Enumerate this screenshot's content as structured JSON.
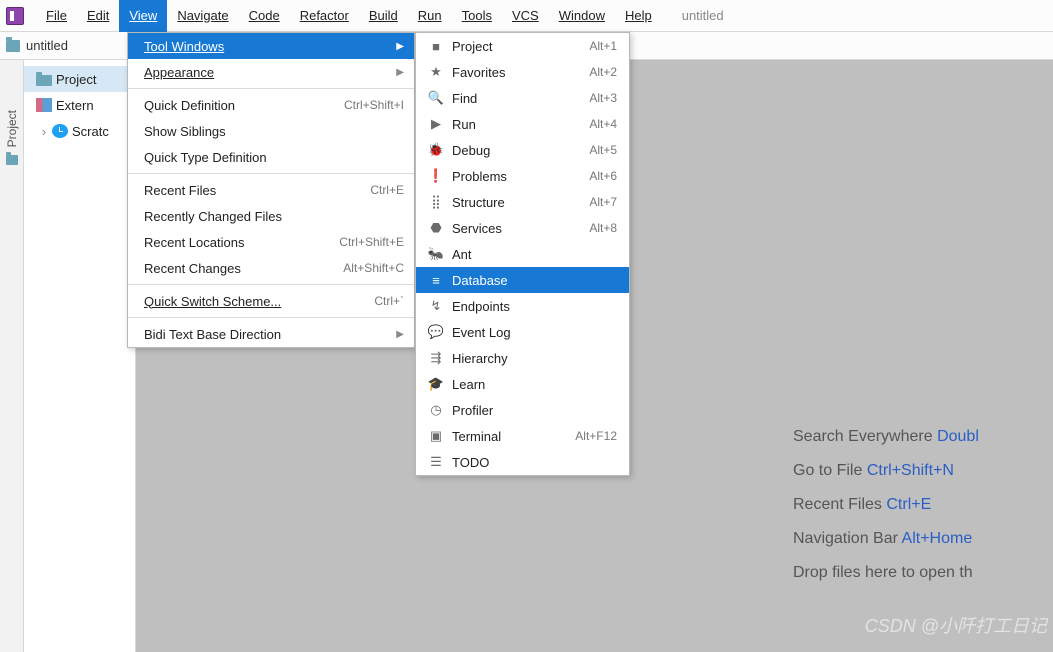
{
  "project_name": "untitled",
  "breadcrumb": "untitled",
  "menubar": {
    "file": "File",
    "edit": "Edit",
    "view": "View",
    "navigate": "Navigate",
    "code": "Code",
    "refactor": "Refactor",
    "build": "Build",
    "run": "Run",
    "tools": "Tools",
    "vcs": "VCS",
    "window": "Window",
    "help": "Help"
  },
  "gutter": {
    "project": "Project"
  },
  "tree": {
    "project": "Project",
    "external": "Extern",
    "scratches": "Scratc"
  },
  "view_menu": {
    "tool_windows": "Tool Windows",
    "appearance": "Appearance",
    "quick_def": {
      "label": "Quick Definition",
      "sc": "Ctrl+Shift+I"
    },
    "show_siblings": "Show Siblings",
    "quick_type_def": "Quick Type Definition",
    "recent_files": {
      "label": "Recent Files",
      "sc": "Ctrl+E"
    },
    "recently_changed": "Recently Changed Files",
    "recent_locations": {
      "label": "Recent Locations",
      "sc": "Ctrl+Shift+E"
    },
    "recent_changes": {
      "label": "Recent Changes",
      "sc": "Alt+Shift+C"
    },
    "quick_switch": {
      "label": "Quick Switch Scheme...",
      "sc": "Ctrl+`"
    },
    "bidi": "Bidi Text Base Direction"
  },
  "tool_windows_submenu": [
    {
      "icon": "project-icon",
      "glyph": "■",
      "label": "Project",
      "sc": "Alt+1"
    },
    {
      "icon": "favorites-icon",
      "glyph": "★",
      "label": "Favorites",
      "sc": "Alt+2"
    },
    {
      "icon": "find-icon",
      "glyph": "🔍",
      "label": "Find",
      "sc": "Alt+3"
    },
    {
      "icon": "run-icon",
      "glyph": "▶",
      "label": "Run",
      "sc": "Alt+4"
    },
    {
      "icon": "debug-icon",
      "glyph": "🐞",
      "label": "Debug",
      "sc": "Alt+5"
    },
    {
      "icon": "problems-icon",
      "glyph": "❗",
      "label": "Problems",
      "sc": "Alt+6"
    },
    {
      "icon": "structure-icon",
      "glyph": "⣿",
      "label": "Structure",
      "sc": "Alt+7"
    },
    {
      "icon": "services-icon",
      "glyph": "⬣",
      "label": "Services",
      "sc": "Alt+8"
    },
    {
      "icon": "ant-icon",
      "glyph": "🐜",
      "label": "Ant",
      "sc": ""
    },
    {
      "icon": "database-icon",
      "glyph": "≡",
      "label": "Database",
      "sc": "",
      "selected": true
    },
    {
      "icon": "endpoints-icon",
      "glyph": "↯",
      "label": "Endpoints",
      "sc": ""
    },
    {
      "icon": "eventlog-icon",
      "glyph": "💬",
      "label": "Event Log",
      "sc": ""
    },
    {
      "icon": "hierarchy-icon",
      "glyph": "⇶",
      "label": "Hierarchy",
      "sc": ""
    },
    {
      "icon": "learn-icon",
      "glyph": "🎓",
      "label": "Learn",
      "sc": ""
    },
    {
      "icon": "profiler-icon",
      "glyph": "◷",
      "label": "Profiler",
      "sc": ""
    },
    {
      "icon": "terminal-icon",
      "glyph": "▣",
      "label": "Terminal",
      "sc": "Alt+F12"
    },
    {
      "icon": "todo-icon",
      "glyph": "☰",
      "label": "TODO",
      "sc": ""
    }
  ],
  "welcome": [
    {
      "text": "Search Everywhere ",
      "hint": "Doubl"
    },
    {
      "text": "Go to File ",
      "hint": "Ctrl+Shift+N"
    },
    {
      "text": "Recent Files ",
      "hint": "Ctrl+E"
    },
    {
      "text": "Navigation Bar ",
      "hint": "Alt+Home"
    },
    {
      "text": "Drop files here to open th",
      "hint": ""
    }
  ],
  "watermark": "CSDN @小阡打工日记"
}
